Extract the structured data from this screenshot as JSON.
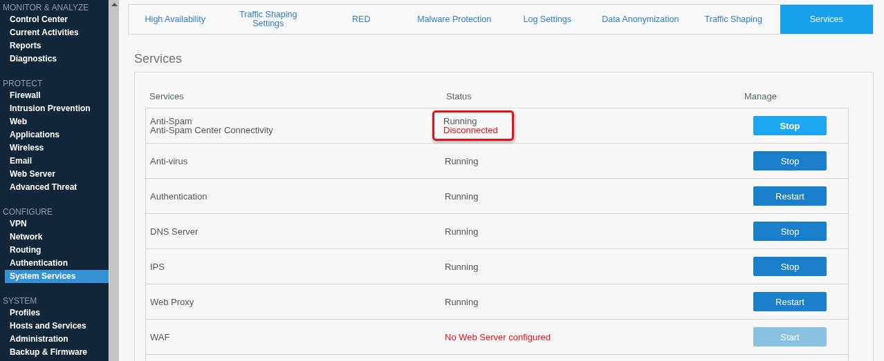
{
  "sidebar": {
    "groups": [
      {
        "heading": "MONITOR & ANALYZE",
        "items": [
          {
            "label": "Control Center",
            "selected": false
          },
          {
            "label": "Current Activities",
            "selected": false
          },
          {
            "label": "Reports",
            "selected": false
          },
          {
            "label": "Diagnostics",
            "selected": false
          }
        ]
      },
      {
        "heading": "PROTECT",
        "items": [
          {
            "label": "Firewall",
            "selected": false
          },
          {
            "label": "Intrusion Prevention",
            "selected": false
          },
          {
            "label": "Web",
            "selected": false
          },
          {
            "label": "Applications",
            "selected": false
          },
          {
            "label": "Wireless",
            "selected": false
          },
          {
            "label": "Email",
            "selected": false
          },
          {
            "label": "Web Server",
            "selected": false
          },
          {
            "label": "Advanced Threat",
            "selected": false
          }
        ]
      },
      {
        "heading": "CONFIGURE",
        "items": [
          {
            "label": "VPN",
            "selected": false
          },
          {
            "label": "Network",
            "selected": false
          },
          {
            "label": "Routing",
            "selected": false
          },
          {
            "label": "Authentication",
            "selected": false
          },
          {
            "label": "System Services",
            "selected": true
          }
        ]
      },
      {
        "heading": "SYSTEM",
        "items": [
          {
            "label": "Profiles",
            "selected": false
          },
          {
            "label": "Hosts and Services",
            "selected": false
          },
          {
            "label": "Administration",
            "selected": false
          },
          {
            "label": "Backup & Firmware",
            "selected": false
          }
        ]
      }
    ]
  },
  "tabs": [
    {
      "label": "High Availability",
      "selected": false
    },
    {
      "label": "Traffic Shaping Settings",
      "selected": false
    },
    {
      "label": "RED",
      "selected": false
    },
    {
      "label": "Malware Protection",
      "selected": false
    },
    {
      "label": "Log Settings",
      "selected": false
    },
    {
      "label": "Data Anonymization",
      "selected": false
    },
    {
      "label": "Traffic Shaping",
      "selected": false
    },
    {
      "label": "Services",
      "selected": true
    }
  ],
  "page_title": "Services",
  "table": {
    "columns": [
      "Services",
      "Status",
      "Manage"
    ],
    "rows": [
      {
        "kind": "full",
        "names": [
          "Anti-Spam",
          "Anti-Spam Center Connectivity"
        ],
        "status": [
          {
            "text": "Running",
            "error": false
          },
          {
            "text": "Disconnected",
            "error": true
          }
        ],
        "status_highlighted": true,
        "button": {
          "label": "Stop",
          "hover": true,
          "disabled": false
        }
      },
      {
        "kind": "full",
        "names": [
          "Anti-virus"
        ],
        "status": [
          {
            "text": "Running",
            "error": false
          }
        ],
        "status_highlighted": false,
        "button": {
          "label": "Stop",
          "hover": false,
          "disabled": false
        }
      },
      {
        "kind": "full",
        "names": [
          "Authentication"
        ],
        "status": [
          {
            "text": "Running",
            "error": false
          }
        ],
        "status_highlighted": false,
        "button": {
          "label": "Restart",
          "hover": false,
          "disabled": false
        }
      },
      {
        "kind": "full",
        "names": [
          "DNS Server"
        ],
        "status": [
          {
            "text": "Running",
            "error": false
          }
        ],
        "status_highlighted": false,
        "button": {
          "label": "Stop",
          "hover": false,
          "disabled": false
        }
      },
      {
        "kind": "full",
        "names": [
          "IPS"
        ],
        "status": [
          {
            "text": "Running",
            "error": false
          }
        ],
        "status_highlighted": false,
        "button": {
          "label": "Stop",
          "hover": false,
          "disabled": false
        }
      },
      {
        "kind": "full",
        "names": [
          "Web Proxy"
        ],
        "status": [
          {
            "text": "Running",
            "error": false
          }
        ],
        "status_highlighted": false,
        "button": {
          "label": "Restart",
          "hover": false,
          "disabled": false
        }
      },
      {
        "kind": "full",
        "names": [
          "WAF"
        ],
        "status": [
          {
            "text": "No Web Server configured",
            "error": true
          }
        ],
        "status_highlighted": false,
        "button": {
          "label": "Start",
          "hover": false,
          "disabled": true
        }
      },
      {
        "kind": "partial"
      }
    ]
  }
}
